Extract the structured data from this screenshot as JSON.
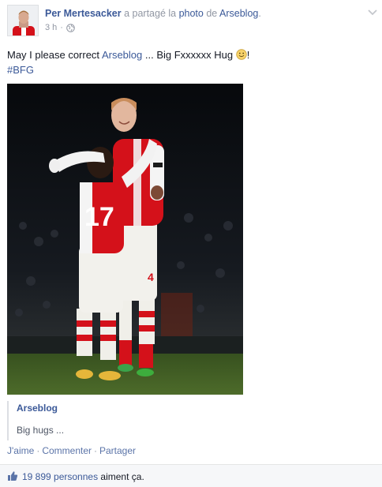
{
  "post": {
    "author": "Per Mertesacker",
    "action_text": " a partagé la ",
    "photo_link": "photo",
    "of_text": " de ",
    "source_page": "Arseblog",
    "period": ".",
    "timestamp": "3 h",
    "timestamp_sep": "·",
    "privacy_icon": "globe-icon",
    "menu_icon": "chevron-down-icon"
  },
  "message": {
    "text_before": "May I please correct ",
    "link": "Arseblog",
    "text_after": " ... Big Fxxxxxx Hug ",
    "emoji": "smile-emoji",
    "text_end": "!",
    "hashtag": "#BFG"
  },
  "shared": {
    "title": "Arseblog",
    "caption": "Big hugs ..."
  },
  "actions": {
    "like": "J'aime",
    "comment": "Commenter",
    "share": "Partager",
    "separator": "·"
  },
  "likes": {
    "icon": "thumbs-up-icon",
    "count_link": "19 899 personnes",
    "suffix": " aiment ça."
  },
  "colors": {
    "link": "#3b5998",
    "muted": "#9197a3",
    "text": "#141823",
    "arsenal_red": "#d4111a"
  }
}
